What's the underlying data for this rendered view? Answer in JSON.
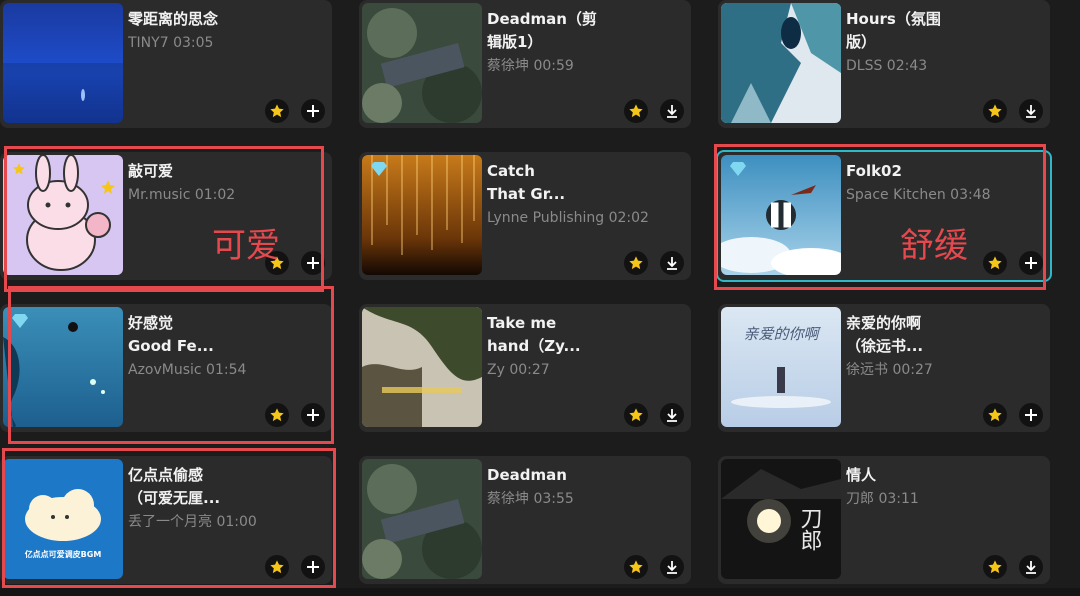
{
  "colors": {
    "accent_playing": "#2fb8c8",
    "annotation": "#e5484d",
    "card_bg": "#2b2b2b",
    "favorite_star": "#f5c518"
  },
  "songs": [
    {
      "title": "零距离的思念",
      "meta": "TINY7 03:05",
      "action": "add"
    },
    {
      "title": "Deadman（剪\n辑版1）",
      "meta": "蔡徐坤 00:59",
      "action": "download"
    },
    {
      "title": "Hours（氛围\n版）",
      "meta": "DLSS 02:43",
      "action": "download"
    },
    {
      "title": "敲可爱",
      "meta": "Mr.music 01:02",
      "action": "add",
      "badge": "star"
    },
    {
      "title": "Catch\nThat Gr...",
      "meta": "Lynne Publishing 02:02",
      "action": "download",
      "badge": "diamond"
    },
    {
      "title": "Folk02",
      "meta": "Space Kitchen 03:48",
      "action": "add",
      "badge": "diamond",
      "state": "playing"
    },
    {
      "title": "好感觉\nGood Fe...",
      "meta": "AzovMusic 01:54",
      "action": "add",
      "badge": "diamond"
    },
    {
      "title": "Take me\nhand（Zy...",
      "meta": "Zy 00:27",
      "action": "download"
    },
    {
      "title": "亲爱的你啊\n（徐远书...",
      "meta": "徐远书 00:27",
      "action": "add"
    },
    {
      "title": "亿点点偷感\n（可爱无厘...",
      "meta": "丢了一个月亮 01:00",
      "action": "add"
    },
    {
      "title": "Deadman",
      "meta": "蔡徐坤 03:55",
      "action": "download"
    },
    {
      "title": "情人",
      "meta": "刀郎 03:11",
      "action": "download"
    }
  ],
  "artwork_text": {
    "cloud_cover": "亿点点可爱调皮BGM",
    "qinai_cover": "亲爱的你啊",
    "qingren_cover": "刀郎"
  },
  "annotations": {
    "cute": "可爱",
    "soothing": "舒缓"
  }
}
